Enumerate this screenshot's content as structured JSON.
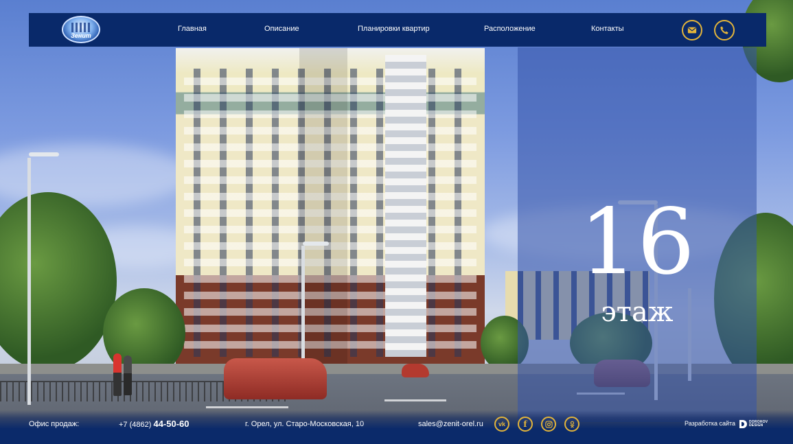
{
  "header": {
    "logo_text": "Зенит",
    "nav": [
      {
        "label": "Главная"
      },
      {
        "label": "Описание"
      },
      {
        "label": "Планировки квартир"
      },
      {
        "label": "Расположение"
      },
      {
        "label": "Контакты"
      }
    ],
    "icons": [
      "mail-icon",
      "phone-icon"
    ],
    "accent_color": "#e4b53a",
    "bar_color": "#09296a"
  },
  "floor": {
    "number": "16",
    "label": "этаж"
  },
  "footer": {
    "office_label": "Офис продаж:",
    "phone_prefix": "+7 (4862)",
    "phone_main": "44-50-60",
    "address": "г. Орел, ул. Старо-Московская, 10",
    "email": "sales@zenit-orel.ru",
    "social": [
      {
        "name": "vk",
        "text": "vk"
      },
      {
        "name": "facebook",
        "text": "f"
      },
      {
        "name": "instagram",
        "text": ""
      },
      {
        "name": "odnoklassniki",
        "text": ""
      }
    ],
    "developer_label": "Разработка сайта",
    "developer_name_1": "DOROHOV",
    "developer_name_2": "DESIGN"
  }
}
